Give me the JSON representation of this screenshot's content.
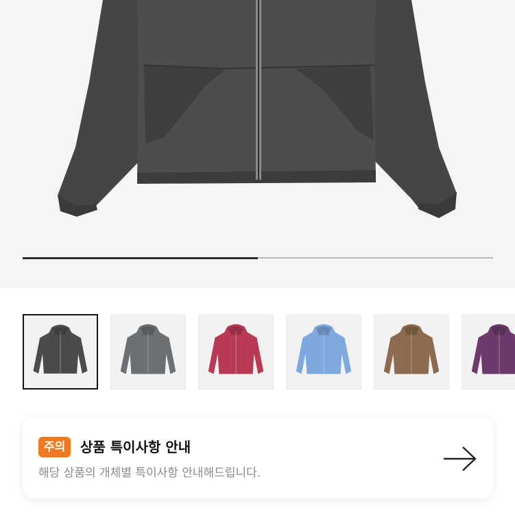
{
  "gallery": {
    "progress": 0.5,
    "hero_color": "#4a4a4c",
    "thumbnails": [
      {
        "color": "charcoal",
        "hex": "#4b4b4d",
        "selected": true
      },
      {
        "color": "grey",
        "hex": "#6c7073",
        "selected": false
      },
      {
        "color": "red",
        "hex": "#b83a55",
        "selected": false
      },
      {
        "color": "blue",
        "hex": "#7fa8de",
        "selected": false
      },
      {
        "color": "brown",
        "hex": "#8c6b4e",
        "selected": false
      },
      {
        "color": "purple",
        "hex": "#6e3a6b",
        "selected": false
      }
    ]
  },
  "notice": {
    "badge": "주의",
    "title": "상품 특이사항 안내",
    "subtitle": "해당 상품의 개체별 특이사항 안내해드립니다.",
    "arrow_icon": "arrow-right-icon",
    "badge_color": "#f0781e"
  }
}
